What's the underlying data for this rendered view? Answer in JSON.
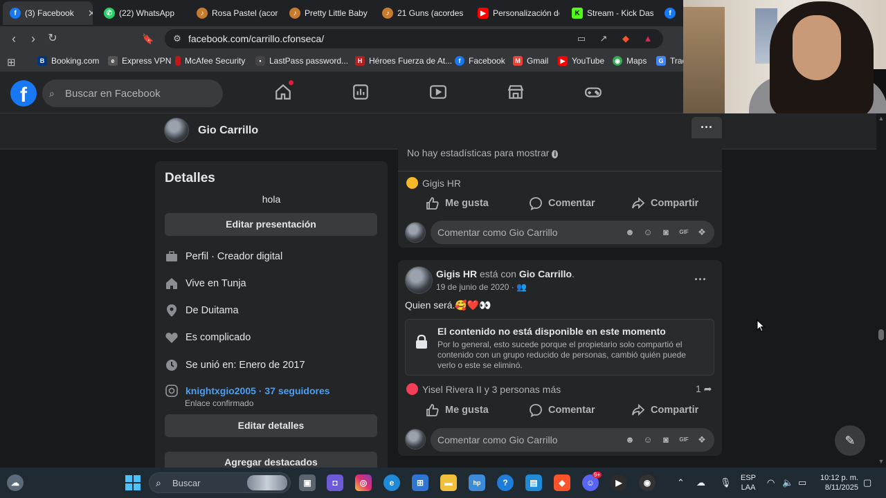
{
  "browser": {
    "tabs": [
      {
        "title": "(3) Facebook",
        "color": "#1877f2",
        "glyph": "f",
        "active": true
      },
      {
        "title": "(22) WhatsApp",
        "color": "#25d366",
        "glyph": "w"
      },
      {
        "title": "Rosa Pastel (acord",
        "color": "#c77b2c",
        "glyph": "♪"
      },
      {
        "title": "Pretty Little Baby",
        "color": "#c77b2c",
        "glyph": "♪"
      },
      {
        "title": "21 Guns (acordes",
        "color": "#c77b2c",
        "glyph": "♪"
      },
      {
        "title": "Personalización de",
        "color": "#ff0000",
        "glyph": "▶"
      },
      {
        "title": "Stream - Kick Das",
        "color": "#53fc18",
        "glyph": "K"
      },
      {
        "title": "",
        "color": "#1877f2",
        "glyph": "f"
      }
    ],
    "url": "facebook.com/carrillo.cfonseca/",
    "bookmarks": [
      {
        "label": "Booking.com",
        "color": "#003580",
        "glyph": "B."
      },
      {
        "label": "Express VPN",
        "color": "#444",
        "glyph": "e"
      },
      {
        "label": "McAfee Security",
        "color": "#c01818",
        "glyph": "M"
      },
      {
        "label": "LastPass password...",
        "color": "#333",
        "glyph": "•"
      },
      {
        "label": "Héroes Fuerza de At...",
        "color": "#b32020",
        "glyph": "H"
      },
      {
        "label": "Facebook",
        "color": "#1877f2",
        "glyph": "f"
      },
      {
        "label": "Gmail",
        "color": "#ea4335",
        "glyph": "M"
      },
      {
        "label": "YouTube",
        "color": "#ff0000",
        "glyph": "▶"
      },
      {
        "label": "Maps",
        "color": "#34a853",
        "glyph": "◉"
      },
      {
        "label": "Trad",
        "color": "#4285f4",
        "glyph": "G"
      }
    ]
  },
  "fb": {
    "logo": "f",
    "search_placeholder": "Buscar en Facebook",
    "profile_name": "Gio Carrillo"
  },
  "details": {
    "title": "Detalles",
    "bio": "hola",
    "edit_presentation": "Editar presentación",
    "rows": [
      {
        "icon": "briefcase-icon",
        "text": "Perfil · Creador digital"
      },
      {
        "icon": "home-icon",
        "text": "Vive en Tunja"
      },
      {
        "icon": "location-pin-icon",
        "text": "De Duitama"
      },
      {
        "icon": "heart-icon",
        "text": "Es complicado"
      },
      {
        "icon": "clock-icon",
        "text": "Se unió en: Enero de 2017"
      }
    ],
    "instagram": "knightxgio2005 · 37 seguidores",
    "instagram_sub": "Enlace confirmado",
    "edit_details": "Editar detalles",
    "add_featured": "Agregar destacados"
  },
  "post1": {
    "no_stats": "No hay estadísticas para mostrar",
    "reactor": "Gigis HR",
    "like": "Me gusta",
    "comment": "Comentar",
    "share": "Compartir",
    "comment_placeholder": "Comentar como Gio Carrillo"
  },
  "post2": {
    "author": "Gigis HR",
    "with_text": "está con",
    "tagged": "Gio Carrillo",
    "date": "19 de junio de 2020",
    "text": "Quien será.🥰❤️👀",
    "unavailable_title": "El contenido no está disponible en este momento",
    "unavailable_desc": "Por lo general, esto sucede porque el propietario solo compartió el contenido con un grupo reducido de personas, cambió quién puede verlo o este se eliminó.",
    "reactors": "Yisel Rivera II y 3 personas más",
    "shares": "1",
    "like": "Me gusta",
    "comment": "Comentar",
    "share": "Compartir",
    "comment_placeholder": "Comentar como Gio Carrillo"
  },
  "taskbar": {
    "search": "Buscar",
    "lang_line1": "ESP",
    "lang_line2": "LAA",
    "time": "10:12 p. m.",
    "date": "8/11/2025",
    "discord_badge": "9+"
  },
  "colors": {
    "fb_blue": "#1877f2",
    "bg": "#18191a",
    "card": "#242526",
    "link": "#4a9ff5"
  }
}
